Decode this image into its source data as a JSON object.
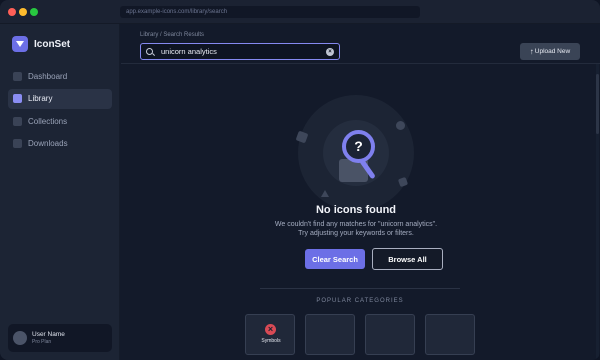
{
  "browser": {
    "url": "app.example-icons.com/library/search"
  },
  "sidebar": {
    "brand": {
      "name": "IconSet",
      "icon": "logo-triangle-icon"
    },
    "items": [
      {
        "label": "Dashboard",
        "active": false
      },
      {
        "label": "Library",
        "active": true
      },
      {
        "label": "Collections",
        "active": false
      },
      {
        "label": "Downloads",
        "active": false
      }
    ],
    "user": {
      "name": "User Name",
      "plan": "Pro Plan"
    }
  },
  "header": {
    "breadcrumb": "Library / Search Results",
    "search": {
      "value": "unicorn analytics",
      "clear_icon": "close-icon"
    },
    "upload_label": "Upload New"
  },
  "empty_state": {
    "lens_glyph": "?",
    "title": "No icons found",
    "message_line1": "We couldn't find any matches for \"unicorn analytics\".",
    "message_line2": "Try adjusting your keywords or filters.",
    "primary_action": "Clear Search",
    "secondary_action": "Browse All"
  },
  "popular": {
    "label": "POPULAR CATEGORIES",
    "cards": [
      {
        "label": "Symbols",
        "icon": "error-x-icon"
      },
      {
        "label": "",
        "icon": ""
      },
      {
        "label": "",
        "icon": ""
      },
      {
        "label": "",
        "icon": ""
      }
    ]
  },
  "colors": {
    "accent": "#6c6fe6",
    "sidebar_bg": "#1c2434",
    "main_bg": "#131a2a",
    "error": "#d84a55"
  }
}
